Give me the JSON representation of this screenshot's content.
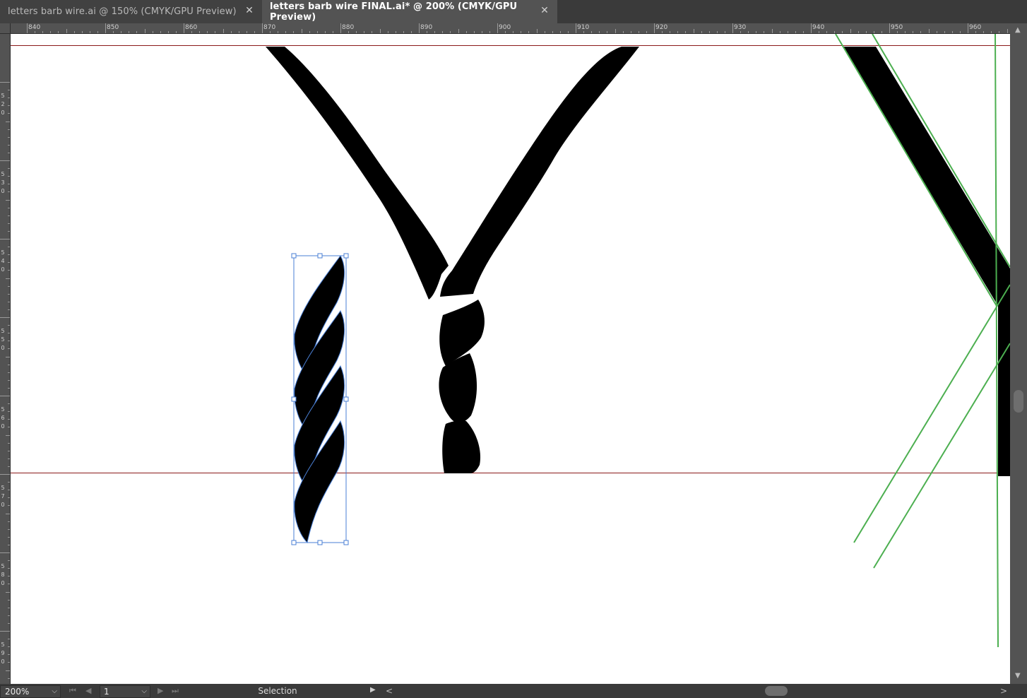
{
  "tabs": [
    {
      "title": "letters barb wire.ai @ 150% (CMYK/GPU Preview)",
      "close": "✕",
      "active": false
    },
    {
      "title": "letters barb wire FINAL.ai* @ 200% (CMYK/GPU Preview)",
      "close": "✕",
      "active": true
    }
  ],
  "ruler": {
    "horizontal_labels": [
      "840",
      "850",
      "860",
      "870",
      "880",
      "890",
      "900",
      "910",
      "920",
      "930",
      "940",
      "950",
      "960"
    ],
    "vertical_labels": [
      "520",
      "530",
      "540",
      "550",
      "560",
      "570",
      "580",
      "590"
    ]
  },
  "canvas": {
    "guide_color": "#8b1a1a",
    "selection_color": "#4a7fd4",
    "line_color": "#4caf50",
    "artwork_color": "#000000"
  },
  "status": {
    "zoom": "200%",
    "page": "1",
    "tool": "Selection",
    "dropdown_glyph": "⌵",
    "first": "⏮",
    "prev": "◀",
    "next": "▶",
    "last": "⏭",
    "play": "▶"
  },
  "scroll": {
    "up": "▲",
    "down": "▼",
    "left": "<",
    "right": ">"
  }
}
